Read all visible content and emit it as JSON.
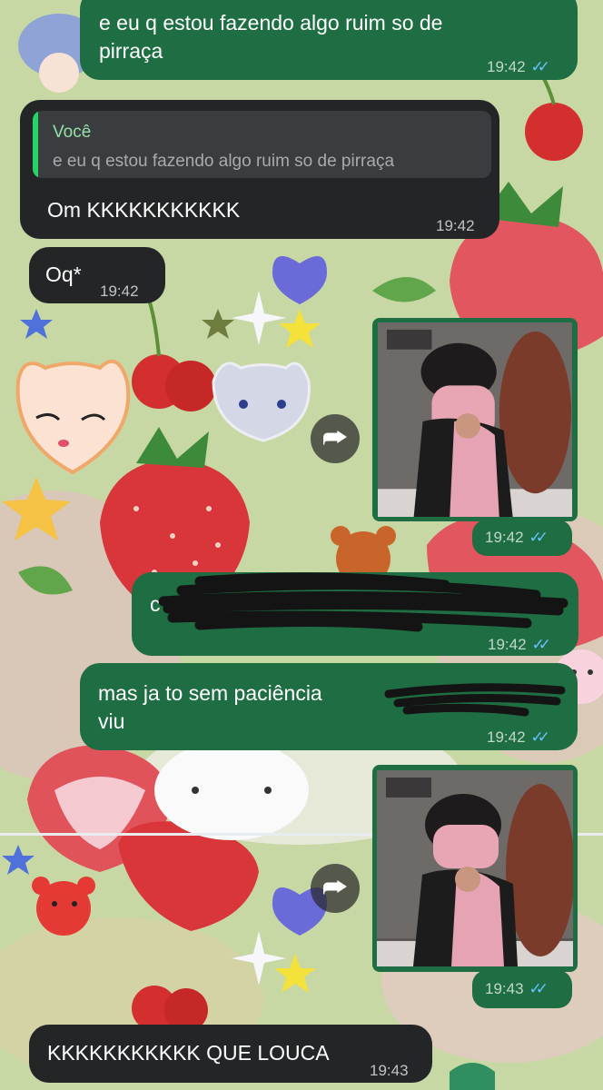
{
  "chat": {
    "messages": [
      {
        "id": "m1",
        "direction": "outgoing",
        "text": "e eu q estou fazendo algo ruim so de\npirraça",
        "time": "19:42",
        "status": "read"
      },
      {
        "id": "m2",
        "direction": "incoming",
        "reply_to": {
          "author": "Você",
          "text": "e eu q estou fazendo algo ruim so de pirraça"
        },
        "text": "Om KKKKKKKKKKK",
        "time": "19:42"
      },
      {
        "id": "m3",
        "direction": "incoming",
        "text": "Oq*",
        "time": "19:42"
      },
      {
        "id": "m4",
        "direction": "outgoing",
        "type": "video",
        "time": "19:42",
        "status": "read"
      },
      {
        "id": "m5",
        "direction": "outgoing",
        "text": "c",
        "redacted": true,
        "time": "19:42",
        "status": "read"
      },
      {
        "id": "m6",
        "direction": "outgoing",
        "text": "mas ja to sem paciência\nviu",
        "redacted_tail": true,
        "time": "19:42",
        "status": "read"
      },
      {
        "id": "m7",
        "direction": "outgoing",
        "type": "video",
        "time": "19:43",
        "status": "read"
      },
      {
        "id": "m8",
        "direction": "incoming",
        "text": "KKKKKKKKKKK QUE LOUCA",
        "time": "19:43"
      }
    ],
    "read_ticks": "✓✓",
    "forward_glyph": "⮫"
  },
  "colors": {
    "outgoing_bubble": "#1f6e43",
    "incoming_bubble": "#232527",
    "read_tick": "#66c2ff",
    "quote_author": "#94e0a6"
  }
}
